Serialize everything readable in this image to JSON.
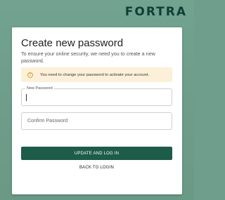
{
  "brand": {
    "name": "FORTRA"
  },
  "card": {
    "title": "Create new password",
    "subtitle": "To ensure your online security, we need you to create a new password."
  },
  "alert": {
    "icon": "info-circle-icon",
    "text": "You need to change your password to activate your account."
  },
  "form": {
    "new_password": {
      "label": "New Password",
      "value": ""
    },
    "confirm_password": {
      "placeholder": "Confirm Password",
      "value": ""
    }
  },
  "actions": {
    "submit_label": "UPDATE AND LOG IN",
    "back_label": "BACK TO LOGIN"
  },
  "colors": {
    "background": "#6f9f8c",
    "primary": "#1d5c48",
    "alert_bg": "#fdf0d8",
    "alert_icon": "#d9a52b"
  }
}
